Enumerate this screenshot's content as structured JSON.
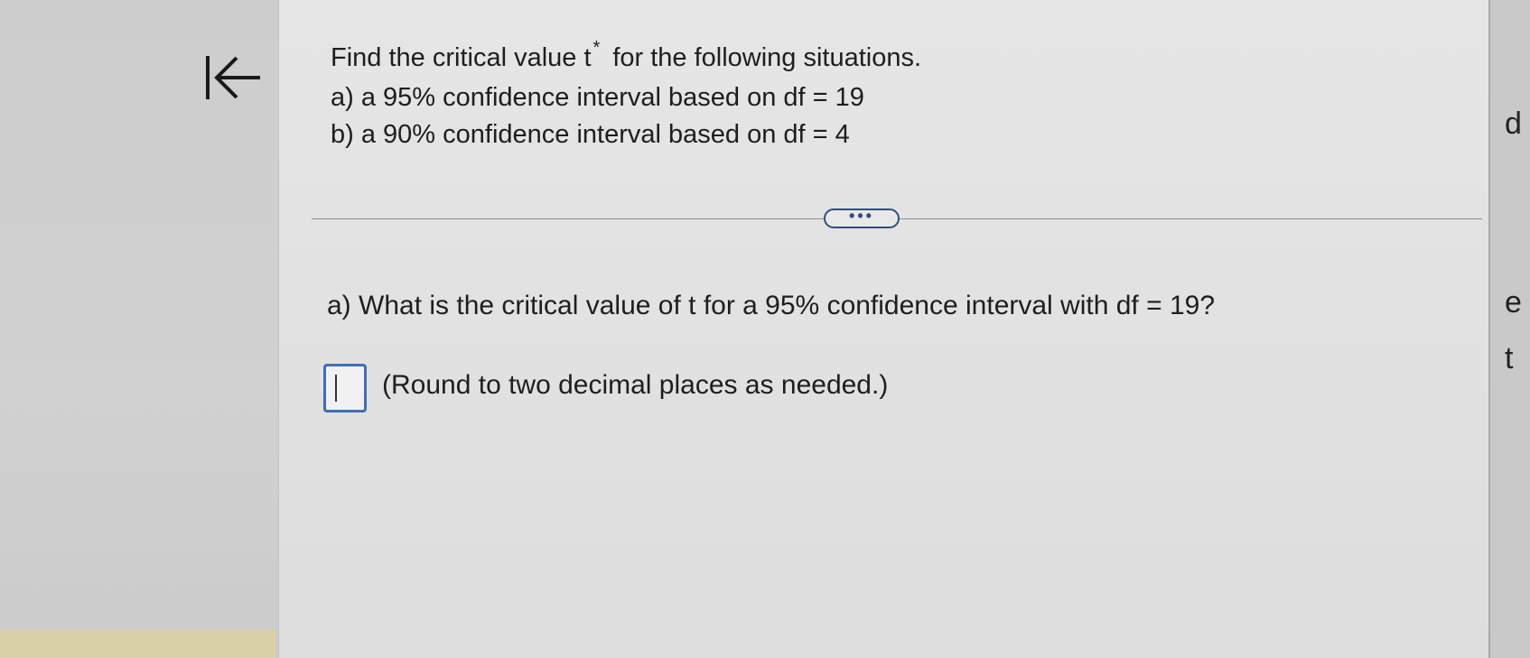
{
  "navigation": {
    "back_icon": "arrow-left-to-line-icon"
  },
  "question": {
    "intro_prefix": "Find the critical value t",
    "intro_superscript": "*",
    "intro_suffix": "for the following situations.",
    "part_a": "a) a 95% confidence interval based on df = 19",
    "part_b": "b) a 90% confidence interval based on df = 4"
  },
  "expand_button": {
    "label": "•••"
  },
  "subquestion": {
    "text": "a) What is the critical value of t for a 95% confidence interval with df = 19?"
  },
  "answer": {
    "value": "",
    "hint": "(Round to two decimal places as needed.)"
  },
  "edge_panel": {
    "glyphs": [
      "d",
      "e",
      "t"
    ]
  },
  "colors": {
    "accent": "#3f6fb4",
    "expand_border": "#2f4f7c",
    "text": "#1e1e1e"
  }
}
